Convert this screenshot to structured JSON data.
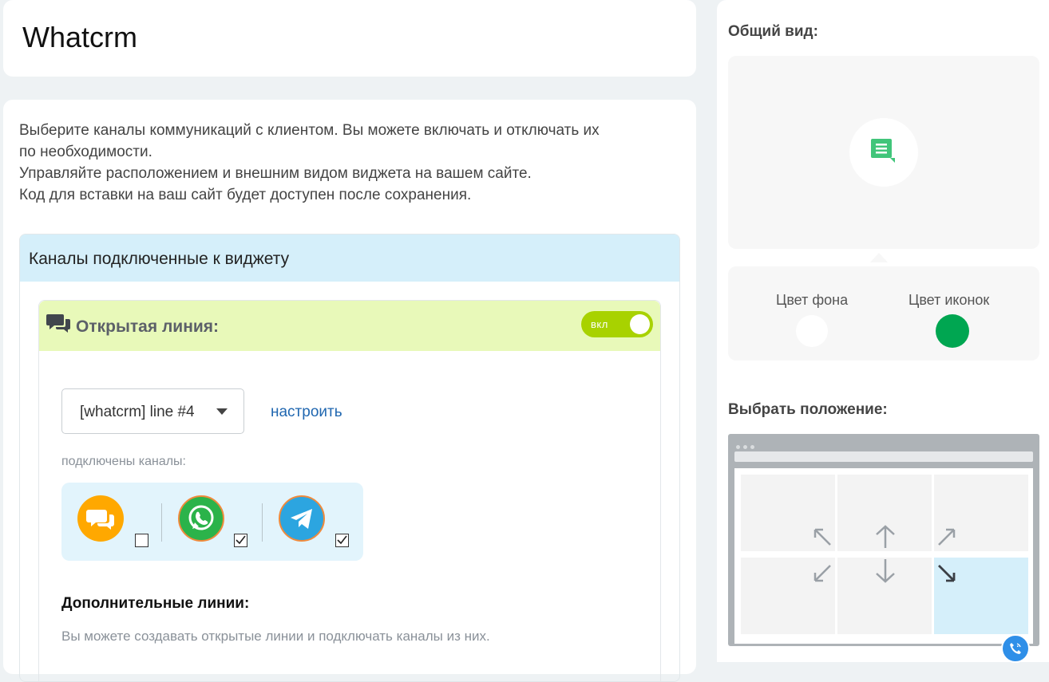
{
  "app": {
    "title": "Whatcrm"
  },
  "intro": {
    "line1": "Выберите каналы коммуникаций с клиентом. Вы можете включать и отключать их",
    "line2": "по необходимости.",
    "line3": "Управляйте расположением и внешним видом виджета на вашем сайте.",
    "line4": "Код для вставки на ваш сайт будет доступен после сохранения."
  },
  "channels_panel": {
    "title": "Каналы подключенные к виджету"
  },
  "open_line": {
    "title": "Открытая линия:",
    "toggle_label": "вкл",
    "toggle_on": true,
    "selected_line": "[whatcrm] line #4",
    "configure_link": "настроить",
    "connected_label": "подключены каналы:",
    "channels": [
      {
        "name": "open-line-chat",
        "icon": "chat-bubbles-icon",
        "color": "#ffa800",
        "checked": false
      },
      {
        "name": "whatsapp",
        "icon": "whatsapp-icon",
        "color": "#2bb34a",
        "checked": true
      },
      {
        "name": "telegram",
        "icon": "telegram-icon",
        "color": "#2ca5e0",
        "checked": true
      }
    ]
  },
  "extra_lines": {
    "title": "Дополнительные линии:",
    "description": "Вы можете создавать открытые линии и подключать каналы из них."
  },
  "sidebar": {
    "overview_title": "Общий вид:",
    "bg_color_label": "Цвет фона",
    "icon_color_label": "Цвет иконок",
    "bg_color": "#ffffff",
    "icon_color": "#00a651",
    "position_title": "Выбрать положение:",
    "selected_position": "bottom-right"
  }
}
